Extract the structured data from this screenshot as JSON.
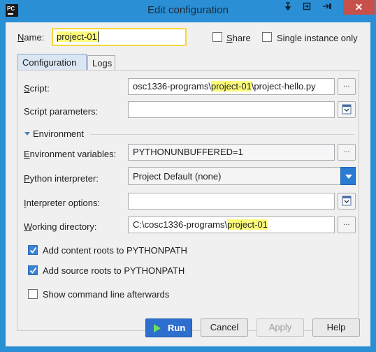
{
  "window": {
    "title": "Edit configuration",
    "app_icon_text": "PC",
    "titlebar_icons": [
      "pin-icon",
      "restore-window-icon",
      "dock-icon"
    ],
    "close_symbol": "✕"
  },
  "name_field": {
    "label_prefix": "N",
    "label_rest": "ame:",
    "value": "project-01"
  },
  "share": {
    "label_prefix": "S",
    "label_rest": "hare",
    "checked": false
  },
  "single_instance": {
    "label": "Single instance only",
    "checked": false
  },
  "tabs": [
    {
      "label": "Configuration",
      "active": true
    },
    {
      "label": "Logs",
      "active": false
    }
  ],
  "script": {
    "label_prefix": "S",
    "label_rest": "cript:",
    "value_before": "osc1336-programs\\",
    "value_highlight": "project-01",
    "value_after": "\\project-hello.py",
    "button": "..."
  },
  "script_parameters": {
    "label": "Script parameters:",
    "value": ""
  },
  "environment": {
    "heading": "Environment"
  },
  "env_vars": {
    "label_prefix": "E",
    "label_rest": "nvironment variables:",
    "value": "PYTHONUNBUFFERED=1",
    "button": "..."
  },
  "python_interpreter": {
    "label_prefix": "P",
    "label_rest": "ython interpreter:",
    "value": "Project Default (none)"
  },
  "interpreter_options": {
    "label_prefix": "I",
    "label_rest": "nterpreter options:",
    "value": ""
  },
  "working_directory": {
    "label_prefix": "W",
    "label_rest": "orking directory:",
    "value_before": "C:\\cosc1336-programs\\",
    "value_highlight": "project-01",
    "button": "..."
  },
  "checkboxes": [
    {
      "label": "Add content roots to PYTHONPATH",
      "checked": true
    },
    {
      "label": "Add source roots to PYTHONPATH",
      "checked": true
    },
    {
      "label": "Show command line afterwards",
      "checked": false
    }
  ],
  "buttons": {
    "run": "Run",
    "cancel": "Cancel",
    "apply": "Apply",
    "help": "Help"
  },
  "colors": {
    "titlebar": "#2a8fd5",
    "highlight": "#fcfc7a",
    "accent": "#2d6fcf",
    "close": "#c7504a"
  }
}
